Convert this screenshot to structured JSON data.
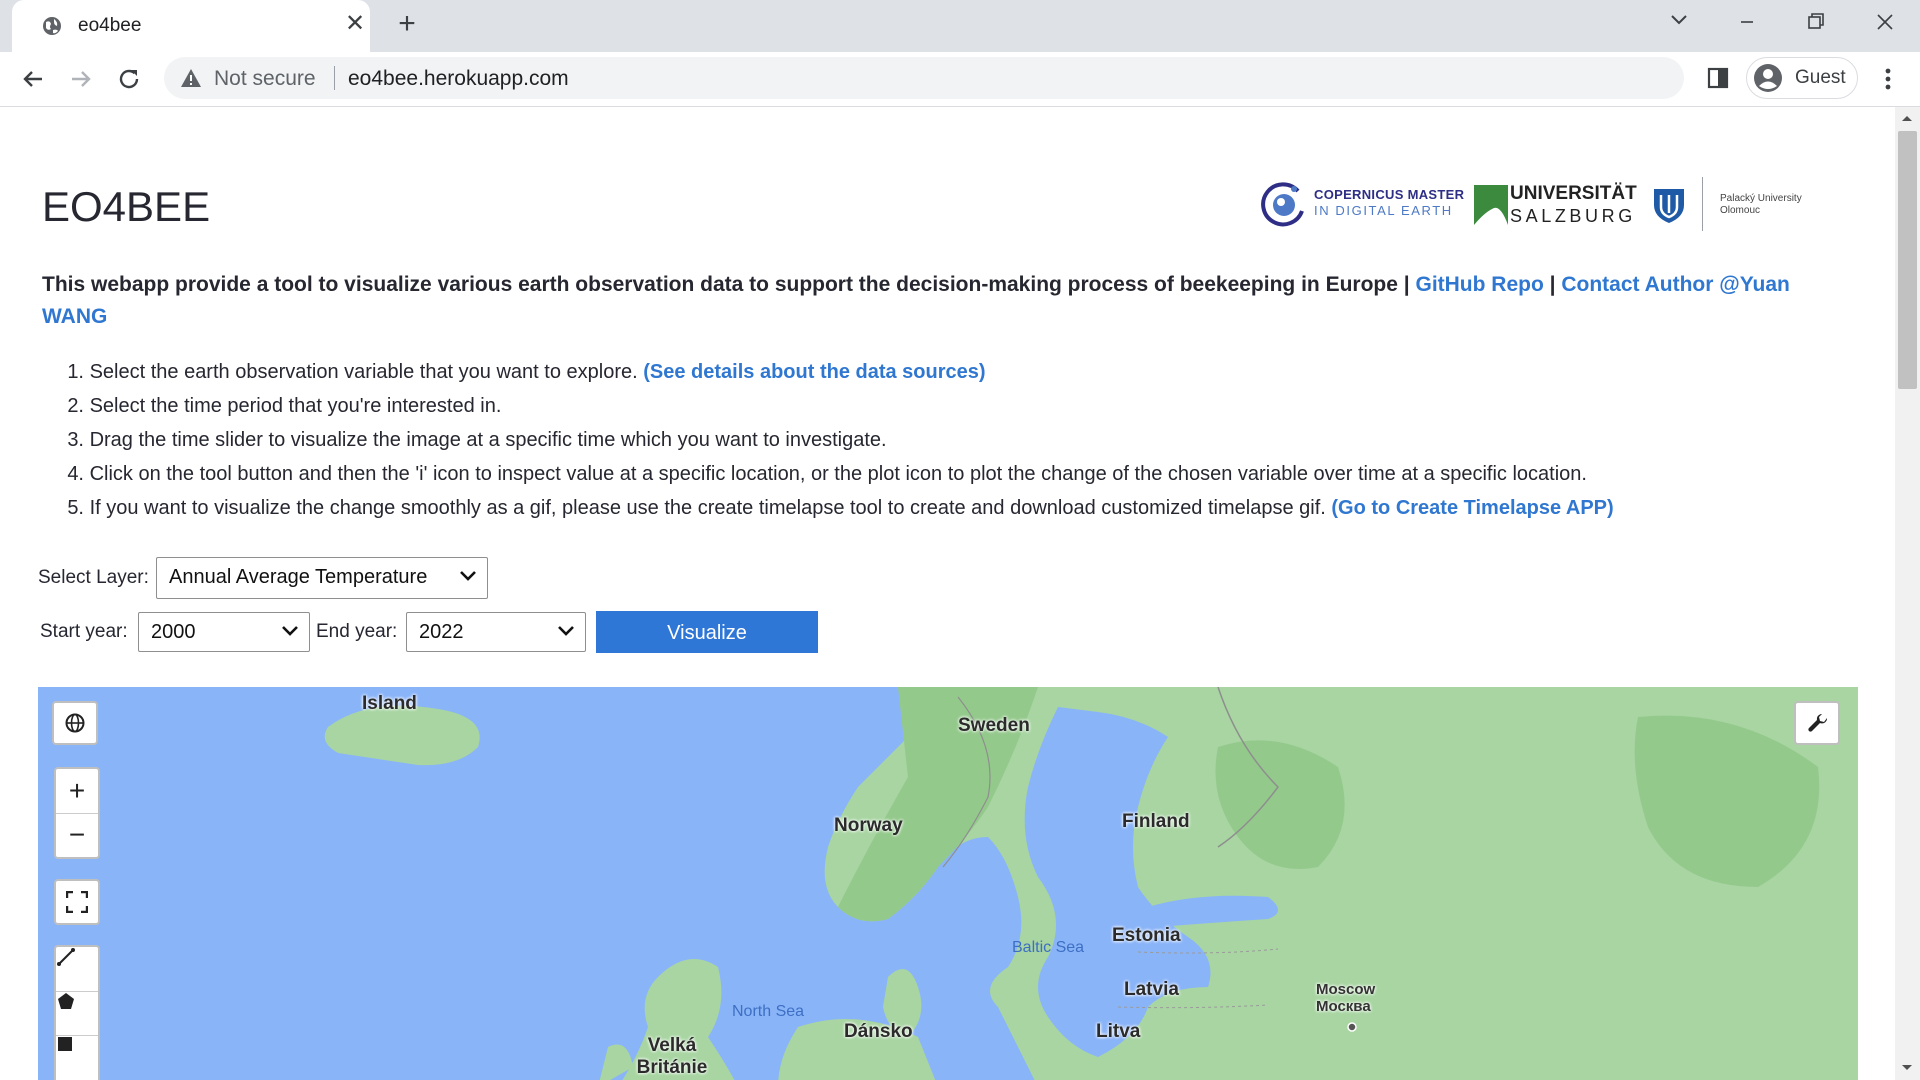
{
  "browser": {
    "tab_title": "eo4bee",
    "security_label": "Not secure",
    "url": "eo4bee.herokuapp.com",
    "profile_name": "Guest"
  },
  "page": {
    "title": "EO4BEE",
    "intro_text": "This webapp provide a tool to visualize various earth observation data to support the decision-making process of beekeeping in Europe | ",
    "github_link": "GitHub Repo",
    "separator": " | ",
    "contact_link": "Contact Author @Yuan WANG",
    "steps": [
      {
        "num": "1.",
        "text": "Select the earth observation variable that you want to explore. ",
        "link": "(See details about the data sources)"
      },
      {
        "num": "2.",
        "text": "Select the time period that you're interested in.",
        "link": ""
      },
      {
        "num": "3.",
        "text": "Drag the time slider to visualize the image at a specific time which you want to investigate.",
        "link": ""
      },
      {
        "num": "4.",
        "text": "Click on the tool button and then the 'i' icon to inspect value at a specific location, or the plot icon to plot the change of the chosen variable over time at a specific location.",
        "link": ""
      },
      {
        "num": "5.",
        "text": "If you want to visualize the change smoothly as a gif, please use the create timelapse tool to create and download customized timelapse gif. ",
        "link": "(Go to Create Timelapse APP)"
      }
    ]
  },
  "logos": {
    "copernicus_line1": "COPERNICUS MASTER",
    "copernicus_line2": "IN DIGITAL EARTH",
    "salzburg_line1": "UNIVERSITÄT",
    "salzburg_line2": "SALZBURG",
    "palacky_line1": "Palacký University",
    "palacky_line2": "Olomouc"
  },
  "controls": {
    "layer_label": "Select Layer:",
    "layer_value": "Annual Average Temperature",
    "start_label": "Start year:",
    "start_value": "2000",
    "end_label": "End year:",
    "end_value": "2022",
    "visualize_label": "Visualize"
  },
  "map": {
    "labels": {
      "island": "Island",
      "sweden": "Sweden",
      "norway": "Norway",
      "finland": "Finland",
      "estonia": "Estonia",
      "latvia": "Latvia",
      "litva": "Litva",
      "dansko": "Dánsko",
      "velka_britanie": "Velká Británie",
      "moscow": "Moscow Москва"
    },
    "seas": {
      "baltic": "Baltic Sea",
      "north": "North Sea"
    },
    "colors": {
      "water": "#8ab4f8",
      "land": "#a8d5a2",
      "forest": "#94c98c"
    }
  }
}
